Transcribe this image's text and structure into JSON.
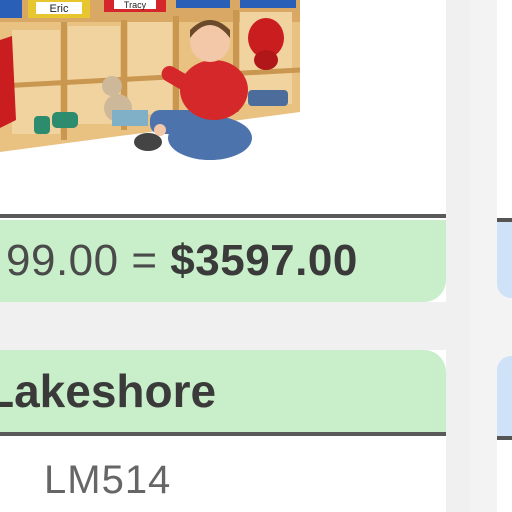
{
  "product": {
    "cubby_labels": [
      "Eric",
      "Tracy"
    ],
    "price_line": {
      "partial_unit_price": "99.00",
      "equals": "=",
      "total": "$3597.00"
    },
    "brand": "Lakeshore",
    "sku": "LM514"
  },
  "colors": {
    "price_band": "#c9efca",
    "divider": "#5a5a5a",
    "side_card": "#cfe2f8"
  }
}
